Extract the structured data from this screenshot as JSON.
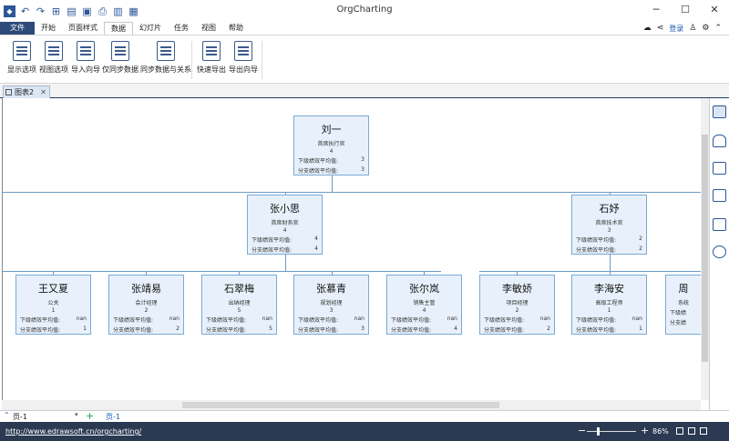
{
  "app": {
    "title": "OrgCharting"
  },
  "quick_access": [
    "undo-icon",
    "redo-icon",
    "new-icon",
    "open-icon",
    "save-icon",
    "print-icon",
    "export-icon",
    "more-icon"
  ],
  "window_controls": {
    "minimize": "─",
    "maximize": "☐",
    "close": "✕"
  },
  "menu": {
    "file": "文件",
    "items": [
      "开始",
      "页面样式",
      "数据",
      "幻灯片",
      "任务",
      "视图",
      "帮助"
    ],
    "active_index": 2
  },
  "right_header": {
    "login": "登录"
  },
  "ribbon": {
    "buttons": [
      "显示选项",
      "视图选项",
      "导入向导",
      "仅同步数据",
      "同步数据与关系",
      "快速导出",
      "导出向导"
    ]
  },
  "doc_tab": {
    "label": "图表2"
  },
  "org": {
    "root": {
      "name": "刘一",
      "title": "首席执行官",
      "count": "4",
      "r1_label": "下级绩效平均值:",
      "r1_val": "3",
      "r2_label": "分支绩效平均值:",
      "r2_val": "3"
    },
    "level2": [
      {
        "name": "张小思",
        "title": "首席财务官",
        "count": "4",
        "r1_label": "下级绩效平均值:",
        "r1_val": "4",
        "r2_label": "分支绩效平均值:",
        "r2_val": "4"
      },
      {
        "name": "石妤",
        "title": "首席技术官",
        "count": "3",
        "r1_label": "下级绩效平均值:",
        "r1_val": "2",
        "r2_label": "分支绩效平均值:",
        "r2_val": "2"
      }
    ],
    "level3": [
      {
        "name": "王又夏",
        "title": "公关",
        "count": "1",
        "r1_label": "下级绩效平均值:",
        "r1_val": "nan",
        "r2_label": "分支绩效平均值:",
        "r2_val": "1"
      },
      {
        "name": "张靖易",
        "title": "会计经理",
        "count": "2",
        "r1_label": "下级绩效平均值:",
        "r1_val": "nan",
        "r2_label": "分支绩效平均值:",
        "r2_val": "2"
      },
      {
        "name": "石翠梅",
        "title": "出纳经理",
        "count": "5",
        "r1_label": "下级绩效平均值:",
        "r1_val": "nan",
        "r2_label": "分支绩效平均值:",
        "r2_val": "5"
      },
      {
        "name": "张慕青",
        "title": "规划经理",
        "count": "3",
        "r1_label": "下级绩效平均值:",
        "r1_val": "nan",
        "r2_label": "分支绩效平均值:",
        "r2_val": "3"
      },
      {
        "name": "张尔岚",
        "title": "销售主管",
        "count": "4",
        "r1_label": "下级绩效平均值:",
        "r1_val": "nan",
        "r2_label": "分支绩效平均值:",
        "r2_val": "4"
      },
      {
        "name": "李敏娇",
        "title": "项目经理",
        "count": "2",
        "r1_label": "下级绩效平均值:",
        "r1_val": "nan",
        "r2_label": "分支绩效平均值:",
        "r2_val": "2"
      },
      {
        "name": "李海安",
        "title": "高级工程师",
        "count": "1",
        "r1_label": "下级绩效平均值:",
        "r1_val": "nan",
        "r2_label": "分支绩效平均值:",
        "r2_val": "1"
      },
      {
        "name": "周",
        "title": "系统",
        "count": "",
        "r1_label": "下级绩",
        "r1_val": "",
        "r2_label": "分支绩",
        "r2_val": ""
      }
    ]
  },
  "pages": {
    "page1": "页-1",
    "page2": "页-1"
  },
  "status": {
    "url": "http://www.edrawsoft.cn/orgcharting/",
    "zoom": "86%"
  }
}
